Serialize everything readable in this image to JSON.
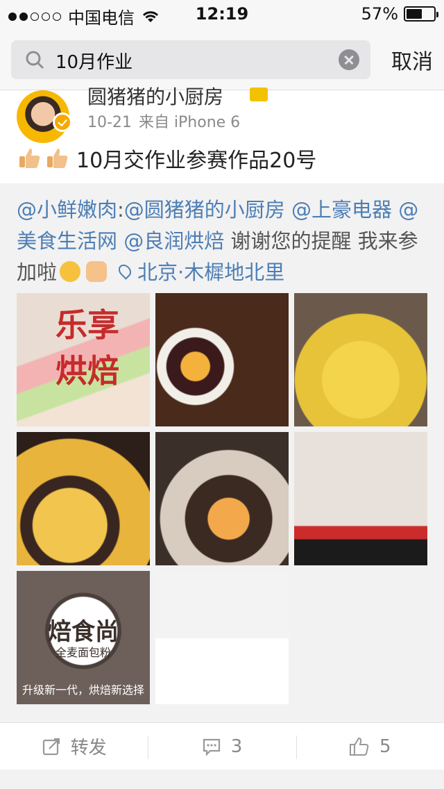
{
  "status_bar": {
    "carrier": "中国电信",
    "time": "12:19",
    "battery": "57%",
    "battery_level": 0.57,
    "signal_bars": 2
  },
  "search": {
    "query": "10月作业",
    "cancel_label": "取消"
  },
  "post": {
    "author": "圆猪猪的小厨房",
    "date": "10-21",
    "source": "来自 iPhone 6",
    "title": "10月交作业参赛作品20号",
    "repost": {
      "mentions": [
        "@小鲜嫩肉",
        "@圆猪猪的小厨房",
        "@上豪电器",
        "@美食生活网",
        "@良润烘焙"
      ],
      "text": "谢谢您的提醒 我来参加啦",
      "location": "北京·木樨地北里"
    },
    "images": {
      "img1_label": "乐享烘焙",
      "img7_logo": "焙食尚",
      "img7_sub": "全麦面包粉",
      "img7_caption": "升级新一代，烘焙新选择"
    }
  },
  "actions": {
    "repost_label": "转发",
    "comment_count": "3",
    "like_count": "5"
  },
  "icons": [
    "search-icon",
    "clear-icon",
    "verified-icon",
    "thumbs-up-icon",
    "location-icon",
    "repost-icon",
    "comment-icon",
    "like-icon",
    "wifi-icon",
    "battery-icon"
  ],
  "colors": {
    "link": "#4d7eb5",
    "verified": "#f7a800"
  }
}
